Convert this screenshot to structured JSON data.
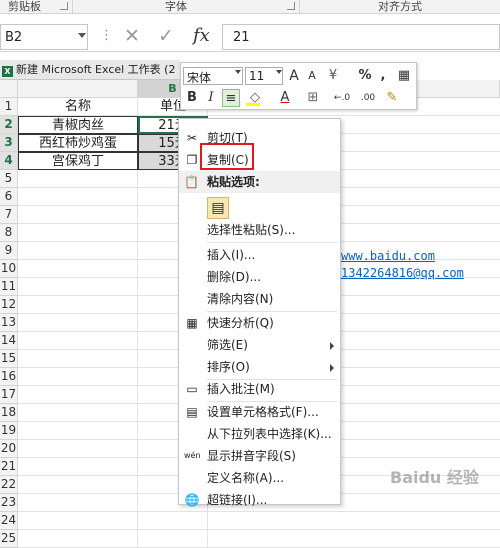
{
  "ribbon": {
    "groups": [
      {
        "label": "剪贴板"
      },
      {
        "label": "字体"
      },
      {
        "label": "对齐方式"
      }
    ]
  },
  "formula_bar": {
    "name_box": "B2",
    "more_glyph": "⋮",
    "cancel_glyph": "✕",
    "enter_glyph": "✓",
    "fx_label": "fx",
    "value": "21"
  },
  "sheet": {
    "window_title": "新建 Microsoft Excel 工作表 (2",
    "columns": [
      {
        "label": ""
      },
      {
        "label": "B"
      }
    ],
    "rows": [
      "1",
      "2",
      "3",
      "4",
      "5",
      "6",
      "7",
      "8",
      "9",
      "10",
      "11",
      "12",
      "13",
      "14",
      "15",
      "16",
      "17",
      "18",
      "19",
      "20",
      "21",
      "22",
      "23",
      "24",
      "25"
    ],
    "cells": {
      "a1": "名称",
      "b1": "单位",
      "a2": "青椒肉丝",
      "b2": "21元",
      "a3": "西红柿炒鸡蛋",
      "b3": "15元",
      "a4": "宫保鸡丁",
      "b4": "33元"
    },
    "links": [
      "www.baidu.com",
      "1342264816@qq.com"
    ]
  },
  "mini_toolbar": {
    "font": "宋体",
    "size": "11",
    "buttons": {
      "grow": "A",
      "shrink": "A",
      "currency": "¥",
      "percent": "%",
      "comma": ",",
      "bold": "B",
      "italic": "I",
      "font_color": "A",
      "inc_decimal": "←.0",
      "dec_decimal": ".00"
    }
  },
  "context_menu": {
    "cut": "剪切(T)",
    "copy": "复制(C)",
    "paste_options": "粘贴选项:",
    "paste_special": "选择性粘贴(S)...",
    "insert": "插入(I)...",
    "delete": "删除(D)...",
    "clear": "清除内容(N)",
    "quick_analysis": "快速分析(Q)",
    "filter": "筛选(E)",
    "sort": "排序(O)",
    "insert_comment": "插入批注(M)",
    "format_cells": "设置单元格格式(F)...",
    "pick_from_list": "从下拉列表中选择(K)...",
    "phonetic": "显示拼音字段(S)",
    "define_name": "定义名称(A)...",
    "hyperlink": "超链接(I)...",
    "phonetic_icon_text": "wén"
  },
  "watermark": "Baidu 经验",
  "colors": {
    "excel_green": "#217346",
    "highlight_red": "#e0191c",
    "link_blue": "#0563c1"
  }
}
